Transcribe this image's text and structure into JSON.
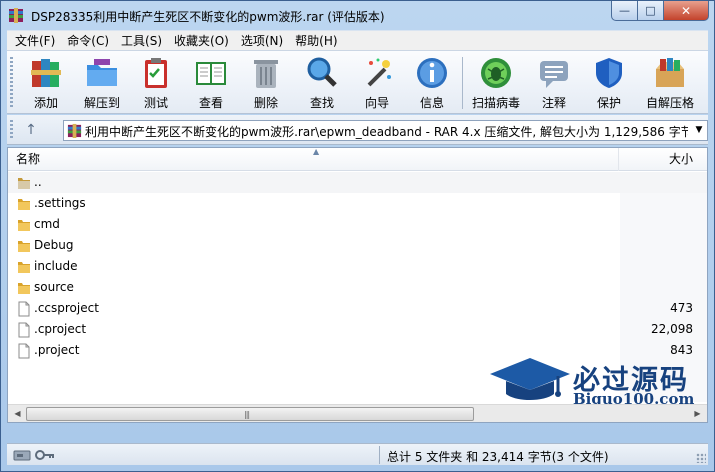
{
  "window": {
    "title": "DSP28335利用中断产生死区不断变化的pwm波形.rar (评估版本)",
    "controls": {
      "minimize": "—",
      "maximize": "□",
      "close": "✕"
    }
  },
  "menu": {
    "items": [
      "文件(F)",
      "命令(C)",
      "工具(S)",
      "收藏夹(O)",
      "选项(N)",
      "帮助(H)"
    ]
  },
  "toolbar": {
    "items": [
      {
        "label": "添加",
        "icon": "books-add-icon"
      },
      {
        "label": "解压到",
        "icon": "folder-extract-icon"
      },
      {
        "label": "测试",
        "icon": "clipboard-test-icon"
      },
      {
        "label": "查看",
        "icon": "book-view-icon"
      },
      {
        "label": "删除",
        "icon": "trash-delete-icon"
      },
      {
        "label": "查找",
        "icon": "magnifier-find-icon"
      },
      {
        "label": "向导",
        "icon": "magic-wand-icon"
      },
      {
        "label": "信息",
        "icon": "info-icon"
      },
      {
        "label": "扫描病毒",
        "icon": "virus-scan-icon"
      },
      {
        "label": "注释",
        "icon": "comment-icon"
      },
      {
        "label": "保护",
        "icon": "shield-protect-icon"
      },
      {
        "label": "自解压格",
        "icon": "box-sfx-icon"
      }
    ]
  },
  "address": {
    "up_glyph": "↑",
    "path": "利用中断产生死区不断变化的pwm波形.rar\\epwm_deadband - RAR 4.x 压缩文件, 解包大小为 1,129,586 字节",
    "dropdown_glyph": "▼"
  },
  "columns": {
    "name": "名称",
    "size": "大小"
  },
  "files": [
    {
      "name": "..",
      "size": "",
      "type": "folder"
    },
    {
      "name": ".settings",
      "size": "",
      "type": "folder"
    },
    {
      "name": "cmd",
      "size": "",
      "type": "folder"
    },
    {
      "name": "Debug",
      "size": "",
      "type": "folder"
    },
    {
      "name": "include",
      "size": "",
      "type": "folder"
    },
    {
      "name": "source",
      "size": "",
      "type": "folder"
    },
    {
      "name": ".ccsproject",
      "size": "473",
      "type": "file"
    },
    {
      "name": ".cproject",
      "size": "22,098",
      "type": "file"
    },
    {
      "name": ".project",
      "size": "843",
      "type": "file"
    }
  ],
  "watermark": {
    "cn": "必过源码",
    "en": "Biguo100.com"
  },
  "status": {
    "summary": "总计 5 文件夹 和 23,414 字节(3 个文件)"
  },
  "colors": {
    "accent": "#17427f",
    "folder": "#e8b53a",
    "titlebar": "#bcd6f0"
  }
}
